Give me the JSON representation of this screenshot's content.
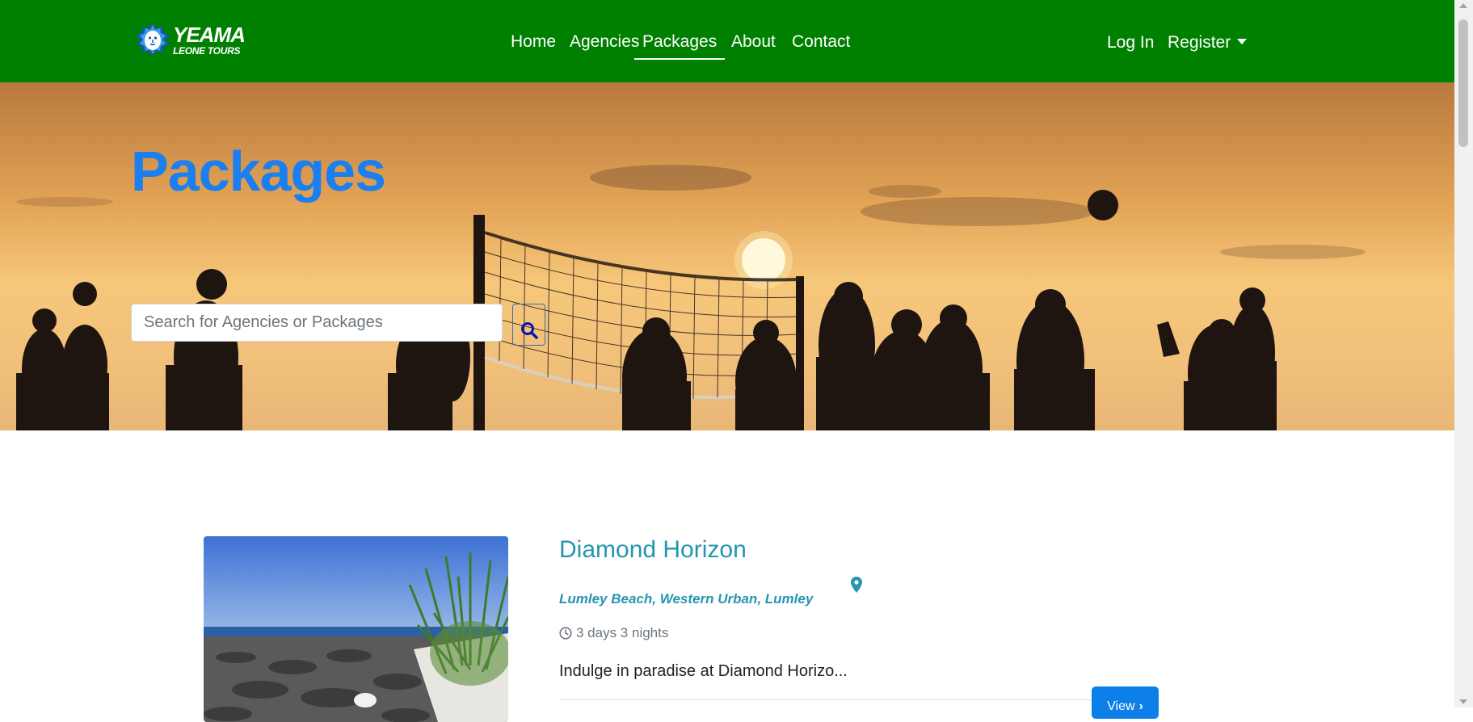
{
  "brand": {
    "line1": "YEAMA",
    "line2": "LEONE TOURS"
  },
  "nav": {
    "home": "Home",
    "agencies": "Agencies",
    "packages": "Packages",
    "about": "About",
    "contact": "Contact",
    "login": "Log In",
    "register": "Register"
  },
  "hero": {
    "title": "Packages",
    "search_placeholder": "Search for Agencies or Packages"
  },
  "package": {
    "title": "Diamond Horizon",
    "location": "Lumley Beach, Western Urban, Lumley",
    "duration": "3 days 3 nights",
    "description": "Indulge in paradise at Diamond Horizo...",
    "view_label": "View"
  },
  "colors": {
    "navbar": "#008000",
    "hero_title": "#1a7ff0",
    "accent_teal": "#2596b0",
    "primary_button": "#0d7fe8"
  },
  "icons": [
    "lion-logo-icon",
    "search-icon",
    "map-pin-icon",
    "clock-icon",
    "chevron-right-icon",
    "caret-down-icon"
  ]
}
